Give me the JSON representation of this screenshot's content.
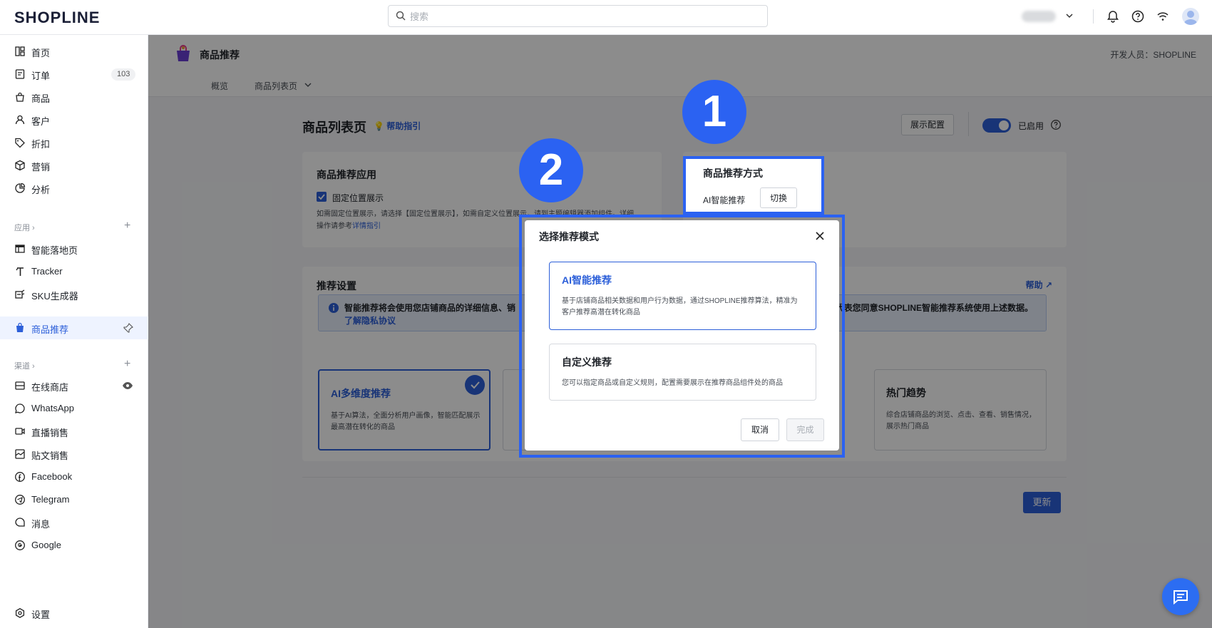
{
  "topbar": {
    "logo": "SHOPLINE",
    "search_placeholder": "搜索"
  },
  "sidebar": {
    "items": [
      {
        "label": "首页",
        "icon": "grid-icon"
      },
      {
        "label": "订单",
        "icon": "order-icon",
        "badge": "103"
      },
      {
        "label": "商品",
        "icon": "bag-icon"
      },
      {
        "label": "客户",
        "icon": "user-icon"
      },
      {
        "label": "折扣",
        "icon": "tag-icon"
      },
      {
        "label": "营销",
        "icon": "box-icon"
      },
      {
        "label": "分析",
        "icon": "chart-pie-icon"
      }
    ],
    "apps_header": "应用 ›",
    "apps": [
      {
        "label": "智能落地页",
        "icon": "layout-icon"
      },
      {
        "label": "Tracker",
        "icon": "tracker-icon"
      },
      {
        "label": "SKU生成器",
        "icon": "sku-icon"
      },
      {
        "label": "商品推荐",
        "icon": "recommend-icon",
        "active": true
      }
    ],
    "channels_header": "渠道 ›",
    "channels": [
      {
        "label": "在线商店",
        "icon": "store-icon"
      },
      {
        "label": "WhatsApp",
        "icon": "whatsapp-icon"
      },
      {
        "label": "直播销售",
        "icon": "live-icon"
      },
      {
        "label": "贴文销售",
        "icon": "post-icon"
      },
      {
        "label": "Facebook",
        "icon": "facebook-icon"
      },
      {
        "label": "Telegram",
        "icon": "telegram-icon"
      },
      {
        "label": "消息",
        "icon": "message-icon"
      },
      {
        "label": "Google",
        "icon": "google-icon"
      }
    ],
    "settings": "设置"
  },
  "page": {
    "app_title": "商品推荐",
    "developer": "开发人员：SHOPLINE",
    "tabs": [
      "概览",
      "商品列表页"
    ],
    "title": "商品列表页",
    "help_guide": "帮助指引",
    "display_config": "展示配置",
    "enabled_label": "已启用"
  },
  "app_card": {
    "title": "商品推荐应用",
    "checkbox_label": "固定位置展示",
    "desc_1": "如需固定位置展示，请选择【固定位置展示】，如需自定义位置展示，请到主题编辑器添加组件。详细",
    "desc_2": "操作请参考",
    "desc_link": "详情指引"
  },
  "method_card": {
    "title": "商品推荐方式",
    "current": "AI智能推荐",
    "switch": "切换"
  },
  "settings_card": {
    "title": "推荐设置",
    "help": "帮助",
    "info_text": "智能推荐将会使用您店铺商品的详细信息、销",
    "info_text_right": "代表您同意SHOPLINE智能推荐系统使用上述数据。",
    "privacy_link": "了解隐私协议",
    "options": [
      {
        "title": "AI多维度推荐",
        "desc": "基于AI算法，全面分析用户画像，智能匹配展示最高潜在转化的商品",
        "selected": true
      },
      {
        "title": "热门趋势",
        "desc": "综合店铺商品的浏览、点击、查看、销售情况，展示热门商品",
        "selected": false
      }
    ],
    "update": "更新"
  },
  "modal": {
    "title": "选择推荐模式",
    "options": [
      {
        "title": "AI智能推荐",
        "desc": "基于店铺商品相关数据和用户行为数据，通过SHOPLINE推荐算法，精准为客户推荐高潜在转化商品",
        "selected": true
      },
      {
        "title": "自定义推荐",
        "desc": "您可以指定商品或自定义规则，配置需要展示在推荐商品组件处的商品",
        "selected": false
      }
    ],
    "cancel": "取消",
    "confirm": "完成"
  },
  "annotations": [
    "1",
    "2"
  ],
  "colors": {
    "accent": "#2c5fd9",
    "highlight": "#2b62f2"
  }
}
